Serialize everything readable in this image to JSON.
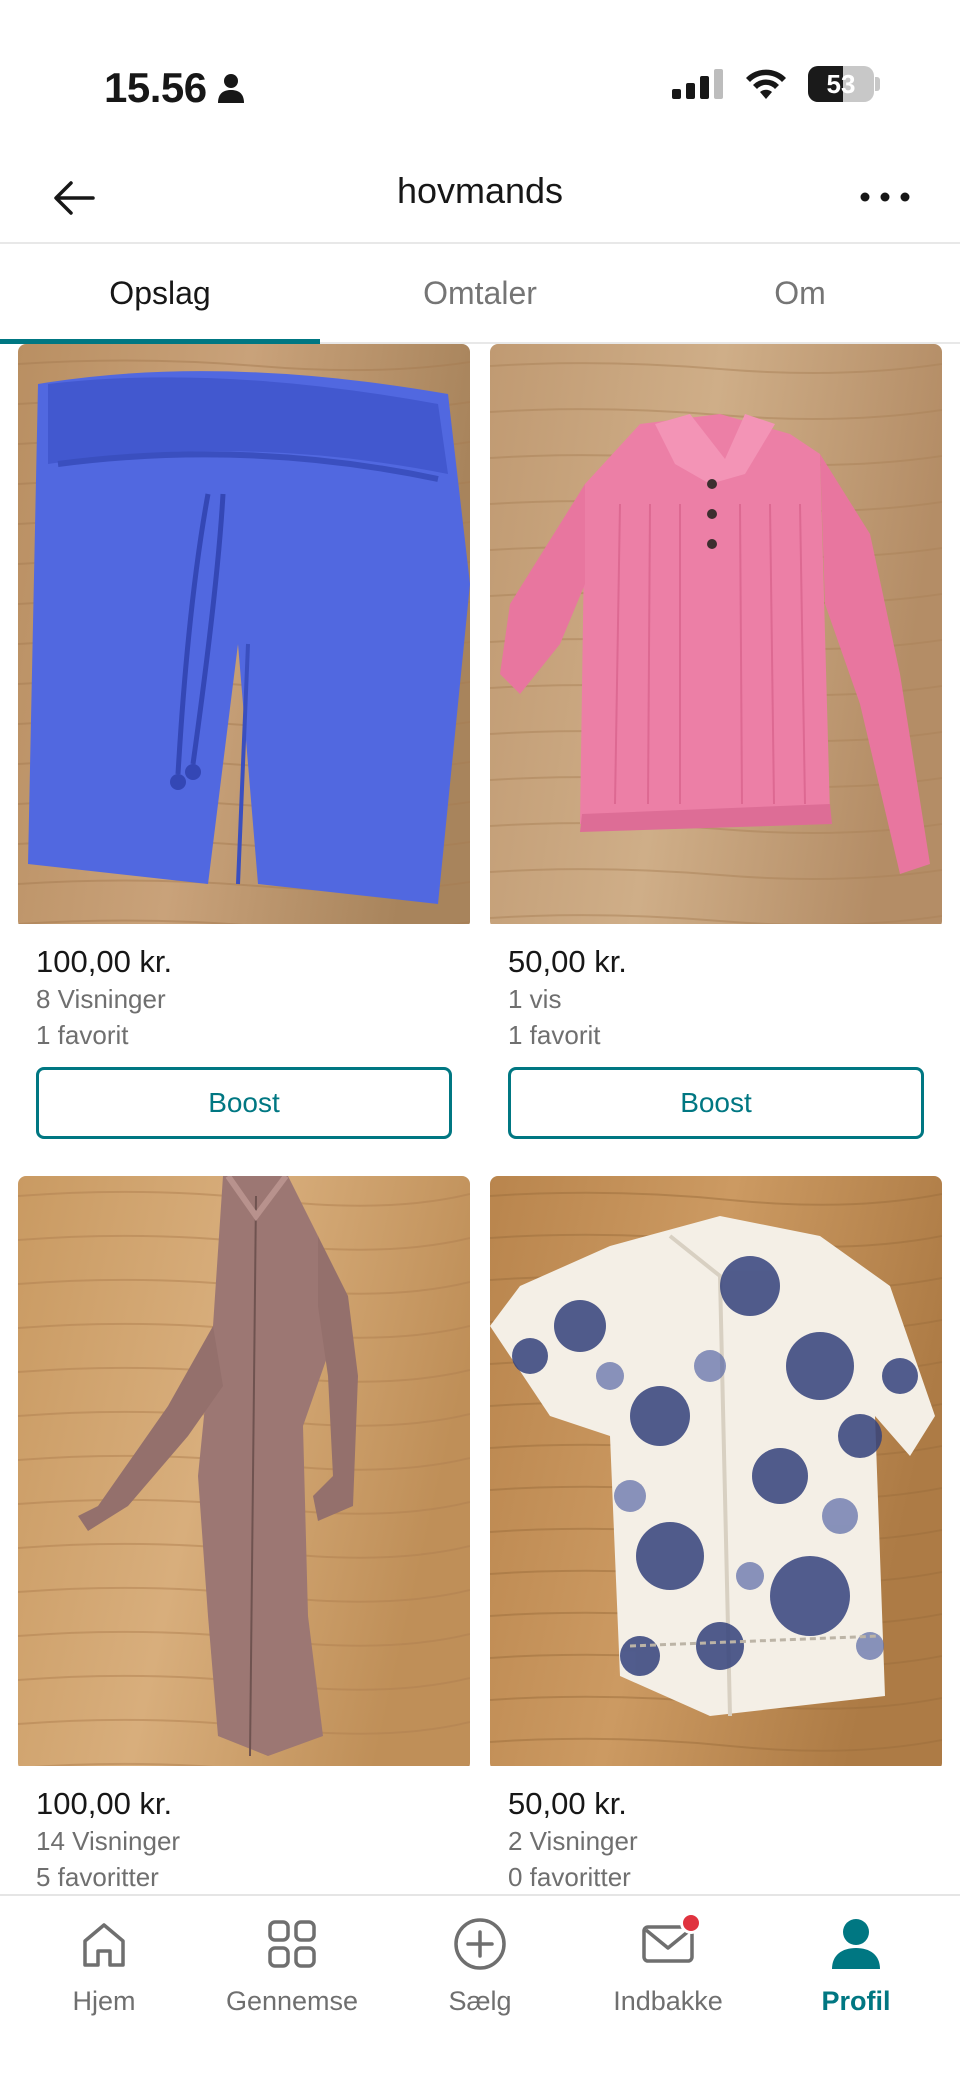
{
  "status_bar": {
    "time": "15.56",
    "battery": "53",
    "battery_level": 0.53
  },
  "header": {
    "title": "hovmands"
  },
  "tabs": [
    {
      "label": "Opslag",
      "active": true
    },
    {
      "label": "Omtaler",
      "active": false
    },
    {
      "label": "Om",
      "active": false
    }
  ],
  "items": [
    {
      "price": "100,00 kr.",
      "views": "8 Visninger",
      "favorites": "1 favorit",
      "boost_label": "Boost",
      "image": "blue-shorts"
    },
    {
      "price": "50,00 kr.",
      "views": "1 vis",
      "favorites": "1 favorit",
      "boost_label": "Boost",
      "image": "pink-knit-polo"
    },
    {
      "price": "100,00 kr.",
      "views": "14 Visninger",
      "favorites": "5 favoritter",
      "image": "mauve-knit-dress"
    },
    {
      "price": "50,00 kr.",
      "views": "2 Visninger",
      "favorites": "0 favoritter",
      "image": "floral-blouse"
    }
  ],
  "nav": [
    {
      "label": "Hjem",
      "icon": "home-icon"
    },
    {
      "label": "Gennemse",
      "icon": "grid-icon"
    },
    {
      "label": "Sælg",
      "icon": "plus-circle-icon"
    },
    {
      "label": "Indbakke",
      "icon": "mail-icon",
      "badge": true
    },
    {
      "label": "Profil",
      "icon": "profile-icon",
      "active": true
    }
  ],
  "colors": {
    "accent": "#007782",
    "badge": "#e0333f",
    "text": "#171717",
    "muted": "#6f6f6f"
  }
}
